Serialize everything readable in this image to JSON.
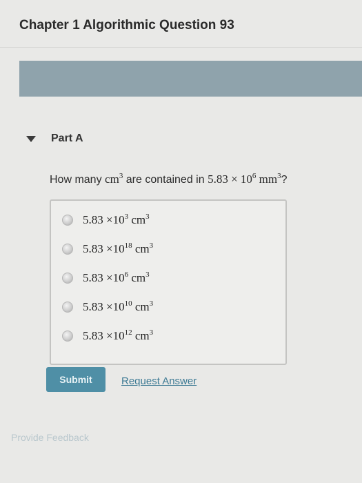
{
  "header": {
    "title": "Chapter 1 Algorithmic Question 93"
  },
  "part": {
    "label": "Part A"
  },
  "question": {
    "prefix": "How many ",
    "unit_a": "cm",
    "unit_a_exp": "3",
    "middle": " are contained in ",
    "value": "5.83 × 10",
    "value_exp": "6",
    "unit_b": " mm",
    "unit_b_exp": "3",
    "suffix": "?"
  },
  "options": [
    {
      "base": "5.83 ×10",
      "exp": "3",
      "unit": "cm",
      "unit_exp": "3"
    },
    {
      "base": "5.83 ×10",
      "exp": "18",
      "unit": "cm",
      "unit_exp": "3"
    },
    {
      "base": "5.83 ×10",
      "exp": "6",
      "unit": "cm",
      "unit_exp": "3"
    },
    {
      "base": "5.83 ×10",
      "exp": "10",
      "unit": "cm",
      "unit_exp": "3"
    },
    {
      "base": "5.83 ×10",
      "exp": "12",
      "unit": "cm",
      "unit_exp": "3"
    }
  ],
  "actions": {
    "submit_label": "Submit",
    "request_label": "Request Answer"
  },
  "footer": {
    "feedback_label": "Provide Feedback"
  }
}
